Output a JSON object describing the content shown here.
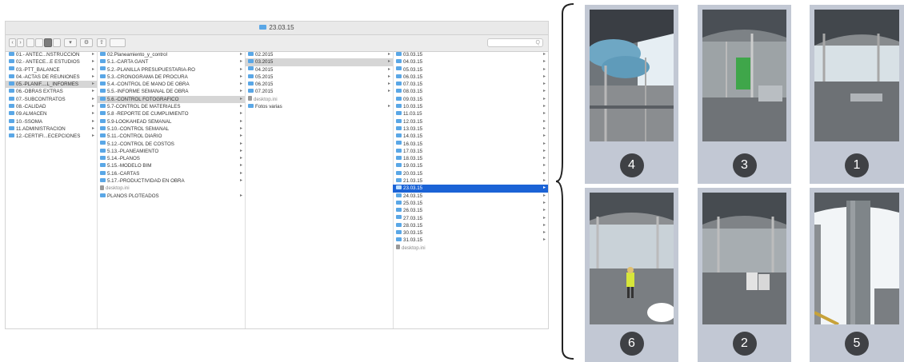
{
  "window": {
    "title": "23.03.15"
  },
  "toolbar": {
    "search_placeholder": "Q"
  },
  "columns": [
    {
      "items": [
        {
          "label": "01.- ANTEC...NSTRUCCION",
          "kind": "folder",
          "arrow": true
        },
        {
          "label": "02.- ANTECE...E ESTUDIOS",
          "kind": "folder",
          "arrow": true
        },
        {
          "label": "03.-PTT_BALANCE",
          "kind": "folder",
          "arrow": true
        },
        {
          "label": "04.-ACTAS DE REUNIONES",
          "kind": "folder",
          "arrow": true
        },
        {
          "label": "05.-PLANIF....L_INFORMES",
          "kind": "folder",
          "arrow": true,
          "selected": "gray"
        },
        {
          "label": "06.-OBRAS EXTRAS",
          "kind": "folder",
          "arrow": true
        },
        {
          "label": "07.-SUBCONTRATOS",
          "kind": "folder",
          "arrow": true
        },
        {
          "label": "08.-CALIDAD",
          "kind": "folder",
          "arrow": true
        },
        {
          "label": "09.ALMACEN",
          "kind": "folder",
          "arrow": true
        },
        {
          "label": "10.-SSOMA",
          "kind": "folder",
          "arrow": true
        },
        {
          "label": "11.ADMINISTRACION",
          "kind": "folder",
          "arrow": true
        },
        {
          "label": "12.-CERTIFI...ECEPCIONES",
          "kind": "folder",
          "arrow": true
        }
      ]
    },
    {
      "items": [
        {
          "label": "02.Planeamiento_y_control",
          "kind": "folder",
          "arrow": true
        },
        {
          "label": "5.1.-CARTA GANT",
          "kind": "folder",
          "arrow": true
        },
        {
          "label": "5.2.-PLANILLA PRESUPUESTARIA-RO",
          "kind": "folder",
          "arrow": true
        },
        {
          "label": "5.3.-CRONOGRAMA DE PROCURA",
          "kind": "folder",
          "arrow": true
        },
        {
          "label": "5.4.-CONTROL DE MANO DE OBRA",
          "kind": "folder",
          "arrow": true
        },
        {
          "label": "5.5.-INFORME SEMANAL DE OBRA",
          "kind": "folder",
          "arrow": true
        },
        {
          "label": "5.6.-CONTROL FOTOGRAFICO",
          "kind": "folder",
          "arrow": true,
          "selected": "gray"
        },
        {
          "label": "5.7-CONTROL DE MATERIALES",
          "kind": "folder",
          "arrow": true
        },
        {
          "label": "5.8 -REPORTE DE CUMPLIMIENTO",
          "kind": "folder",
          "arrow": true
        },
        {
          "label": "5.9-LOOKAHEAD SEMANAL",
          "kind": "folder",
          "arrow": true
        },
        {
          "label": "5.10.-CONTROL SEMANAL",
          "kind": "folder",
          "arrow": true
        },
        {
          "label": "5.11.-CONTROL DIARIO",
          "kind": "folder",
          "arrow": true
        },
        {
          "label": "5.12.-CONTROL DE COSTOS",
          "kind": "folder",
          "arrow": true
        },
        {
          "label": "5.13.-PLANEAMIENTO",
          "kind": "folder",
          "arrow": true
        },
        {
          "label": "5.14.-PLANOS",
          "kind": "folder",
          "arrow": true
        },
        {
          "label": "5.15.-MODELO BIM",
          "kind": "folder",
          "arrow": true
        },
        {
          "label": "5.16.-CARTAS",
          "kind": "folder",
          "arrow": true
        },
        {
          "label": "5.17.-PRODUCTIVIDAD EN OBRA",
          "kind": "folder",
          "arrow": true
        },
        {
          "label": "desktop.ini",
          "kind": "doc",
          "arrow": false,
          "muted": true
        },
        {
          "label": "PLANOS PLOTEADOS",
          "kind": "folder",
          "arrow": true
        }
      ]
    },
    {
      "items": [
        {
          "label": "02.2015",
          "kind": "folder",
          "arrow": true
        },
        {
          "label": "03.2015",
          "kind": "folder",
          "arrow": true,
          "selected": "gray"
        },
        {
          "label": "04.2015",
          "kind": "folder",
          "arrow": true
        },
        {
          "label": "05.2015",
          "kind": "folder",
          "arrow": true
        },
        {
          "label": "06.2015",
          "kind": "folder",
          "arrow": true
        },
        {
          "label": "07.2015",
          "kind": "folder",
          "arrow": true
        },
        {
          "label": "desktop.ini",
          "kind": "doc",
          "arrow": false,
          "muted": true
        },
        {
          "label": "Fotos varias",
          "kind": "folder",
          "arrow": true
        }
      ]
    },
    {
      "items": [
        {
          "label": "03.03.15",
          "kind": "folder",
          "arrow": true
        },
        {
          "label": "04.03.15",
          "kind": "folder",
          "arrow": true
        },
        {
          "label": "05.03.15",
          "kind": "folder",
          "arrow": true
        },
        {
          "label": "06.03.15",
          "kind": "folder",
          "arrow": true
        },
        {
          "label": "07.03.15",
          "kind": "folder",
          "arrow": true
        },
        {
          "label": "08.03.15",
          "kind": "folder",
          "arrow": true
        },
        {
          "label": "09.03.15",
          "kind": "folder",
          "arrow": true
        },
        {
          "label": "10.03.15",
          "kind": "folder",
          "arrow": true
        },
        {
          "label": "11.03.15",
          "kind": "folder",
          "arrow": true
        },
        {
          "label": "12.03.15",
          "kind": "folder",
          "arrow": true
        },
        {
          "label": "13.03.15",
          "kind": "folder",
          "arrow": true
        },
        {
          "label": "14.03.15",
          "kind": "folder",
          "arrow": true
        },
        {
          "label": "16.03.15",
          "kind": "folder",
          "arrow": true
        },
        {
          "label": "17.03.15",
          "kind": "folder",
          "arrow": true
        },
        {
          "label": "18.03.15",
          "kind": "folder",
          "arrow": true
        },
        {
          "label": "19.03.15",
          "kind": "folder",
          "arrow": true
        },
        {
          "label": "20.03.15",
          "kind": "folder",
          "arrow": true
        },
        {
          "label": "21.03.15",
          "kind": "folder",
          "arrow": true
        },
        {
          "label": "23.03.15",
          "kind": "folder",
          "arrow": true,
          "selected": "blue"
        },
        {
          "label": "24.03.15",
          "kind": "folder",
          "arrow": true
        },
        {
          "label": "25.03.15",
          "kind": "folder",
          "arrow": true
        },
        {
          "label": "26.03.15",
          "kind": "folder",
          "arrow": true
        },
        {
          "label": "27.03.15",
          "kind": "folder",
          "arrow": true
        },
        {
          "label": "28.03.15",
          "kind": "folder",
          "arrow": true
        },
        {
          "label": "30.03.15",
          "kind": "folder",
          "arrow": true
        },
        {
          "label": "31.03.15",
          "kind": "folder",
          "arrow": true
        },
        {
          "label": "desktop.ini",
          "kind": "doc",
          "arrow": false,
          "muted": true
        }
      ]
    }
  ],
  "photos": [
    {
      "number": "4",
      "scene": "pipes"
    },
    {
      "number": "3",
      "scene": "interior-green"
    },
    {
      "number": "1",
      "scene": "deck"
    },
    {
      "number": "6",
      "scene": "worker"
    },
    {
      "number": "2",
      "scene": "interior-bags"
    },
    {
      "number": "5",
      "scene": "column"
    }
  ],
  "colors": {
    "selection_blue": "#1b63d6",
    "folder_blue": "#5aa7e6",
    "card_bg": "#c2c8d4",
    "badge_bg": "#3f4145"
  }
}
